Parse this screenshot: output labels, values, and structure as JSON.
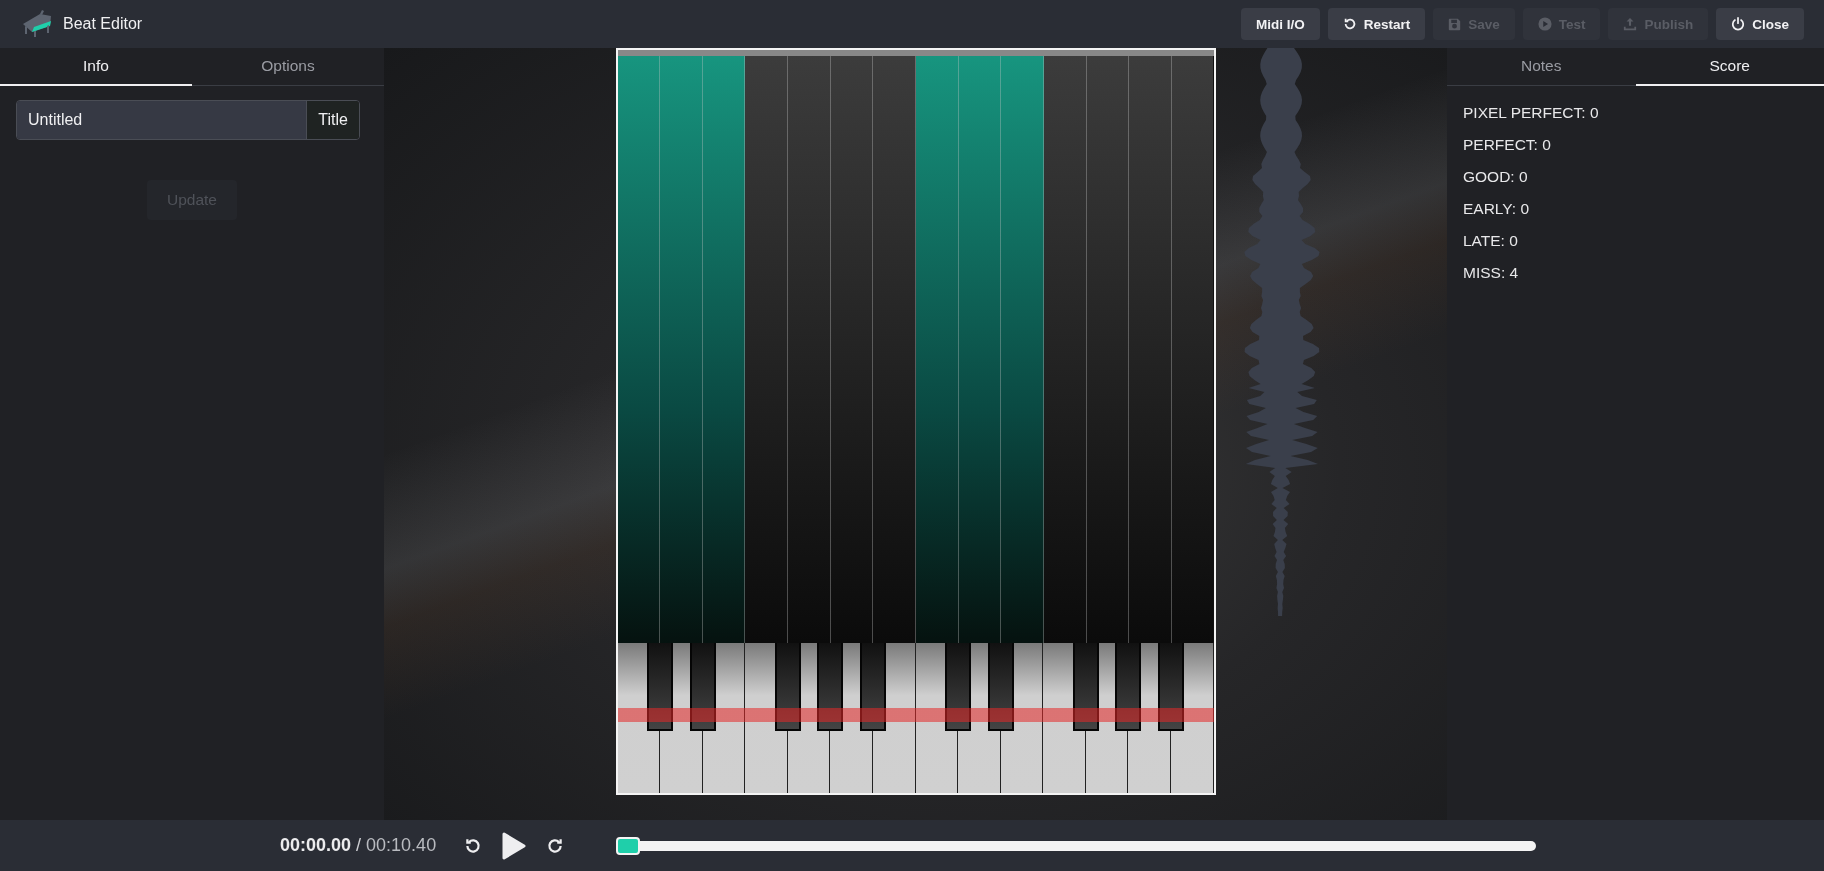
{
  "app": {
    "title": "Beat Editor"
  },
  "toolbar": [
    {
      "label": "Midi I/O",
      "kind": "plain",
      "disabled": false
    },
    {
      "label": "Restart",
      "kind": "restart",
      "disabled": false
    },
    {
      "label": "Save",
      "kind": "save",
      "disabled": true
    },
    {
      "label": "Test",
      "kind": "test",
      "disabled": true
    },
    {
      "label": "Publish",
      "kind": "publish",
      "disabled": true
    },
    {
      "label": "Close",
      "kind": "close",
      "disabled": false
    }
  ],
  "left_panel": {
    "tabs": [
      {
        "label": "Info",
        "selected": true
      },
      {
        "label": "Options",
        "selected": false
      }
    ],
    "title_field": {
      "value": "Untitled",
      "addon": "Title"
    },
    "update_button": {
      "label": "Update",
      "disabled": true
    }
  },
  "stage": {
    "lanes": [
      {
        "lit": true
      },
      {
        "lit": true
      },
      {
        "lit": true
      },
      {
        "lit": false
      },
      {
        "lit": false
      },
      {
        "lit": false
      },
      {
        "lit": false
      },
      {
        "lit": true
      },
      {
        "lit": true
      },
      {
        "lit": true
      },
      {
        "lit": false
      },
      {
        "lit": false
      },
      {
        "lit": false
      },
      {
        "lit": false
      }
    ]
  },
  "right_panel": {
    "tabs": [
      {
        "label": "Notes",
        "selected": false
      },
      {
        "label": "Score",
        "selected": true
      }
    ],
    "score": [
      "PIXEL PERFECT: 0",
      "PERFECT: 0",
      "GOOD: 0",
      "EARLY: 0",
      "LATE: 0",
      "MISS: 4"
    ]
  },
  "player": {
    "current_time": "00:00.00",
    "separator": "/",
    "total_time": "00:10.40",
    "progress": {
      "level": 0
    }
  }
}
